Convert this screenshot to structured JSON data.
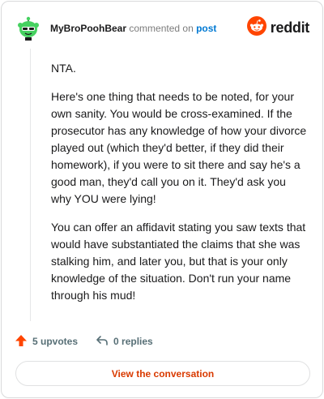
{
  "comment": {
    "username": "MyBroPoohBear",
    "commented_text": "commented on",
    "post_link": "post",
    "paragraphs": [
      "NTA.",
      "Here's one thing that needs to be noted, for your own sanity. You would be cross-examined. If the prosecutor has any knowledge of how your divorce played out (which they'd better, if they did their homework), if you were to sit there and say he's a good man, they'd call you on it. They'd ask you why YOU were lying!",
      "You can offer an affidavit stating you saw texts that would have substantiated the claims that she was stalking him, and later you, but that is your only knowledge of the situation. Don't run your name through his mud!"
    ]
  },
  "brand": {
    "name": "reddit",
    "icon": "reddit-logo-icon",
    "color": "#ff4500"
  },
  "actions": {
    "upvotes": "5 upvotes",
    "replies": "0 replies",
    "upvote_icon": "upvote-arrow-icon",
    "reply_icon": "reply-arrow-icon"
  },
  "cta": {
    "label": "View the conversation"
  },
  "colors": {
    "accent": "#d93a00",
    "link": "#0079d3",
    "upvote": "#ff4500"
  }
}
